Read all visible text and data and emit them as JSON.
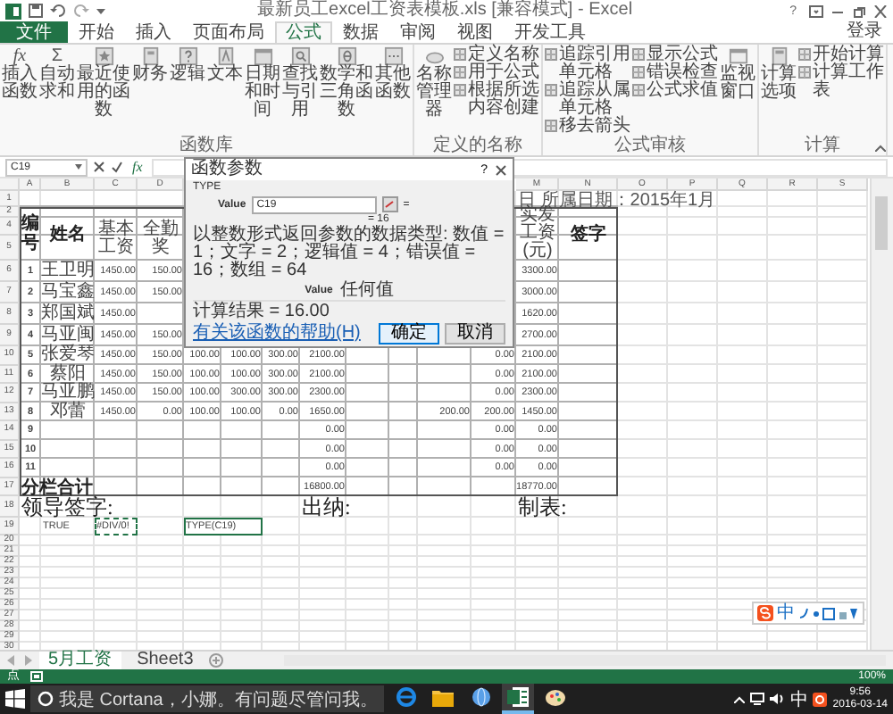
{
  "window": {
    "title": "最新员工excel工资表模板.xls [兼容模式] - Excel",
    "help": "?"
  },
  "ribbon_tabs": [
    {
      "label": "文件",
      "kind": "file",
      "selected": false
    },
    {
      "label": "开始",
      "kind": "tab",
      "selected": false
    },
    {
      "label": "插入",
      "kind": "tab",
      "selected": false
    },
    {
      "label": "页面布局",
      "kind": "tab",
      "selected": false
    },
    {
      "label": "公式",
      "kind": "tab",
      "selected": true
    },
    {
      "label": "数据",
      "kind": "tab",
      "selected": false
    },
    {
      "label": "审阅",
      "kind": "tab",
      "selected": false
    },
    {
      "label": "视图",
      "kind": "tab",
      "selected": false
    },
    {
      "label": "开发工具",
      "kind": "tab",
      "selected": false
    }
  ],
  "account": {
    "label": "登录"
  },
  "ribbon_groups": [
    {
      "label": "函数库",
      "items": [
        {
          "kind": "large",
          "label": "插入函数",
          "glyph": "fx"
        },
        {
          "kind": "large",
          "label": "自动求和",
          "glyph": "Σ"
        },
        {
          "kind": "large",
          "label": "最近使用的函数"
        },
        {
          "kind": "large",
          "label": "财务"
        },
        {
          "kind": "large",
          "label": "逻辑"
        },
        {
          "kind": "large",
          "label": "文本"
        },
        {
          "kind": "large",
          "label": "日期和时间"
        },
        {
          "kind": "large",
          "label": "查找与引用"
        },
        {
          "kind": "large",
          "label": "数学和三角函数"
        },
        {
          "kind": "large",
          "label": "其他函数"
        }
      ]
    },
    {
      "label": "定义的名称",
      "items": [
        {
          "kind": "large",
          "label": "名称管理器"
        },
        {
          "kind": "small",
          "label": "定义名称"
        },
        {
          "kind": "small",
          "label": "用于公式"
        },
        {
          "kind": "small",
          "label": "根据所选内容创建"
        }
      ]
    },
    {
      "label": "公式审核",
      "items": [
        {
          "kind": "small",
          "label": "追踪引用单元格"
        },
        {
          "kind": "small",
          "label": "追踪从属单元格"
        },
        {
          "kind": "small",
          "label": "移去箭头"
        },
        {
          "kind": "small",
          "label": "显示公式"
        },
        {
          "kind": "small",
          "label": "错误检查"
        },
        {
          "kind": "small",
          "label": "公式求值"
        },
        {
          "kind": "large",
          "label": "监视窗口"
        }
      ]
    },
    {
      "label": "计算",
      "items": [
        {
          "kind": "large",
          "label": "计算选项"
        },
        {
          "kind": "small",
          "label": "开始计算"
        },
        {
          "kind": "small",
          "label": "计算工作表"
        }
      ]
    }
  ],
  "formula_bar": {
    "name_box": "C19",
    "function_label": "fx"
  },
  "dialog": {
    "title": "函数参数",
    "help": "?",
    "function": "TYPE",
    "argument": {
      "label": "Value",
      "value": "C19",
      "equals": "="
    },
    "preview": "= 16",
    "description": "以整数形式返回参数的数据类型: 数值 = 1；文字 = 2；逻辑值 = 4；错误值 = 16；数组 = 64",
    "argument_help": {
      "name": "Value",
      "text": "任何值"
    },
    "result": "计算结果 =  16.00",
    "help_link": "有关该函数的帮助(H)",
    "buttons": [
      {
        "label": "确定",
        "focused": true
      },
      {
        "label": "取消",
        "focused": false
      }
    ]
  },
  "sheet": {
    "column_headers": [
      "A",
      "B",
      "C",
      "D",
      "M",
      "N",
      "O",
      "P",
      "Q",
      "R",
      "S"
    ],
    "rows": [
      {
        "number": "1",
        "cells": [
          {
            "kind": "note",
            "text": "日 所属日期：2015年1月"
          }
        ]
      },
      {
        "number": "2",
        "cells": [
          {
            "kind": "big",
            "text": "编号"
          },
          {
            "kind": "big",
            "text": "姓名"
          },
          {
            "kind": "header",
            "text": "实发工资(元)"
          },
          {
            "kind": "big",
            "text": "签字"
          }
        ]
      },
      {
        "number": "4",
        "cells": [
          {
            "kind": "header",
            "text": "基本工资"
          },
          {
            "kind": "header",
            "text": "全勤奖"
          }
        ]
      },
      {
        "number": "5"
      },
      {
        "number": "6",
        "cells": [
          {
            "kind": "index",
            "text": "1"
          },
          {
            "kind": "name",
            "text": "王卫明"
          },
          {
            "kind": "num",
            "text": "1450.00"
          },
          {
            "kind": "num",
            "text": "150.00"
          },
          {
            "kind": "num",
            "text": "3300.00"
          }
        ]
      },
      {
        "number": "7",
        "cells": [
          {
            "kind": "index",
            "text": "2"
          },
          {
            "kind": "name",
            "text": "马宝鑫"
          },
          {
            "kind": "num",
            "text": "1450.00"
          },
          {
            "kind": "num",
            "text": "150.00"
          },
          {
            "kind": "num",
            "text": "3000.00"
          }
        ]
      },
      {
        "number": "8",
        "cells": [
          {
            "kind": "index",
            "text": "3"
          },
          {
            "kind": "name",
            "text": "郑国斌"
          },
          {
            "kind": "num",
            "text": "1450.00"
          },
          {
            "kind": "num",
            "text": "1620.00"
          }
        ]
      },
      {
        "number": "9",
        "cells": [
          {
            "kind": "index",
            "text": "4"
          },
          {
            "kind": "name",
            "text": "马亚闽"
          },
          {
            "kind": "num",
            "text": "1450.00"
          },
          {
            "kind": "num",
            "text": "150.00"
          },
          {
            "kind": "num",
            "text": "2700.00"
          }
        ]
      },
      {
        "number": "10",
        "cells": [
          {
            "kind": "index",
            "text": "5"
          },
          {
            "kind": "name",
            "text": "张爱琴"
          },
          {
            "kind": "num",
            "text": "1450.00"
          },
          {
            "kind": "num",
            "text": "150.00"
          },
          {
            "kind": "num",
            "text": "100.00"
          },
          {
            "kind": "num",
            "text": "100.00"
          },
          {
            "kind": "num",
            "text": "300.00"
          },
          {
            "kind": "num",
            "text": "2100.00"
          },
          {
            "kind": "num",
            "text": "0.00"
          },
          {
            "kind": "num",
            "text": "2100.00"
          }
        ]
      },
      {
        "number": "11",
        "cells": [
          {
            "kind": "index",
            "text": "6"
          },
          {
            "kind": "name",
            "text": "蔡阳"
          },
          {
            "kind": "num",
            "text": "1450.00"
          },
          {
            "kind": "num",
            "text": "150.00"
          },
          {
            "kind": "num",
            "text": "100.00"
          },
          {
            "kind": "num",
            "text": "100.00"
          },
          {
            "kind": "num",
            "text": "300.00"
          },
          {
            "kind": "num",
            "text": "2100.00"
          },
          {
            "kind": "num",
            "text": "0.00"
          },
          {
            "kind": "num",
            "text": "2100.00"
          }
        ]
      },
      {
        "number": "12",
        "cells": [
          {
            "kind": "index",
            "text": "7"
          },
          {
            "kind": "name",
            "text": "马亚鹏"
          },
          {
            "kind": "num",
            "text": "1450.00"
          },
          {
            "kind": "num",
            "text": "150.00"
          },
          {
            "kind": "num",
            "text": "100.00"
          },
          {
            "kind": "num",
            "text": "300.00"
          },
          {
            "kind": "num",
            "text": "300.00"
          },
          {
            "kind": "num",
            "text": "2300.00"
          },
          {
            "kind": "num",
            "text": "0.00"
          },
          {
            "kind": "num",
            "text": "2300.00"
          }
        ]
      },
      {
        "number": "13",
        "cells": [
          {
            "kind": "index",
            "text": "8"
          },
          {
            "kind": "name",
            "text": "邓蕾"
          },
          {
            "kind": "num",
            "text": "1450.00"
          },
          {
            "kind": "num",
            "text": "0.00"
          },
          {
            "kind": "num",
            "text": "100.00"
          },
          {
            "kind": "num",
            "text": "100.00"
          },
          {
            "kind": "num",
            "text": "0.00"
          },
          {
            "kind": "num",
            "text": "1650.00"
          },
          {
            "kind": "num",
            "text": "200.00"
          },
          {
            "kind": "num",
            "text": "200.00"
          },
          {
            "kind": "num",
            "text": "1450.00"
          }
        ]
      },
      {
        "number": "14",
        "cells": [
          {
            "kind": "index",
            "text": "9"
          },
          {
            "kind": "num",
            "text": "0.00"
          },
          {
            "kind": "num",
            "text": "0.00"
          },
          {
            "kind": "num",
            "text": "0.00"
          }
        ]
      },
      {
        "number": "15",
        "cells": [
          {
            "kind": "index",
            "text": "10"
          },
          {
            "kind": "num",
            "text": "0.00"
          },
          {
            "kind": "num",
            "text": "0.00"
          },
          {
            "kind": "num",
            "text": "0.00"
          }
        ]
      },
      {
        "number": "16",
        "cells": [
          {
            "kind": "index",
            "text": "11"
          },
          {
            "kind": "num",
            "text": "0.00"
          },
          {
            "kind": "num",
            "text": "0.00"
          },
          {
            "kind": "num",
            "text": "0.00"
          }
        ]
      },
      {
        "number": "17",
        "cells": [
          {
            "kind": "total",
            "text": "分栏合计"
          },
          {
            "kind": "num",
            "text": "16800.00"
          },
          {
            "kind": "num",
            "text": "18770.00"
          }
        ]
      },
      {
        "number": "18",
        "cells": [
          {
            "kind": "label",
            "text": "领导签字:"
          },
          {
            "kind": "label",
            "text": "出纳:"
          },
          {
            "kind": "label",
            "text": "制表:"
          }
        ]
      },
      {
        "number": "19",
        "cells": [
          {
            "kind": "plain",
            "text": "TRUE"
          },
          {
            "kind": "marquee",
            "text": "#DIV/0!"
          },
          {
            "kind": "active",
            "text": "TYPE(C19)"
          }
        ]
      },
      {
        "number": "20"
      },
      {
        "number": "21"
      },
      {
        "number": "22"
      },
      {
        "number": "23"
      },
      {
        "number": "24"
      },
      {
        "number": "25"
      },
      {
        "number": "26"
      },
      {
        "number": "27"
      },
      {
        "number": "28"
      },
      {
        "number": "29"
      },
      {
        "number": "30"
      }
    ]
  },
  "ime_toolbar": {
    "mode": "中"
  },
  "sheet_tabs": [
    {
      "label": "5月工资",
      "selected": true
    },
    {
      "label": "Sheet3",
      "selected": false
    }
  ],
  "status_bar": {
    "mode": "点",
    "zoom": "100%"
  },
  "taskbar": {
    "search": "我是 Cortana，小娜。有问题尽管问我。",
    "apps": [
      {
        "active": false
      },
      {
        "active": false
      },
      {
        "active": false
      },
      {
        "active": true
      },
      {
        "active": false
      }
    ],
    "ime": "中",
    "time": "9:56",
    "date": "2016-03-14"
  }
}
